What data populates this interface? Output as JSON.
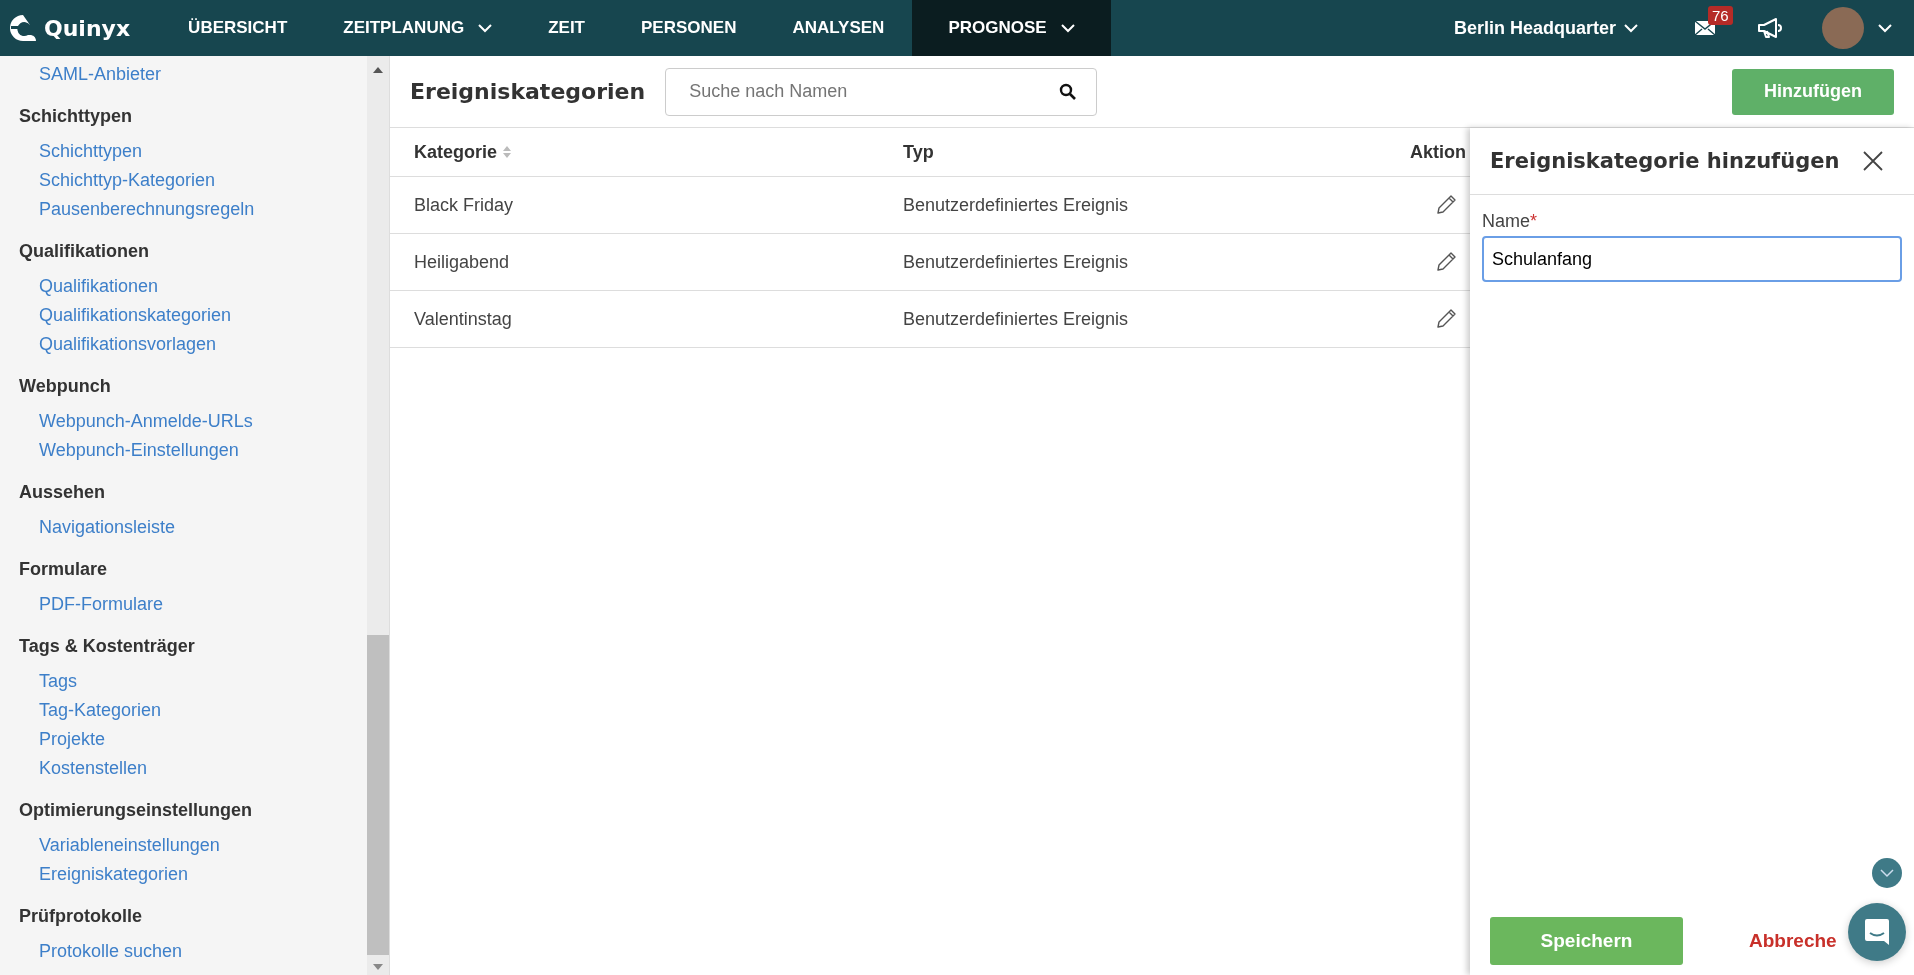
{
  "nav": {
    "logo": "Quinyx",
    "items": [
      {
        "label": "ÜBERSICHT",
        "has_menu": false,
        "selected": false
      },
      {
        "label": "ZEITPLANUNG",
        "has_menu": true,
        "selected": false
      },
      {
        "label": "ZEIT",
        "has_menu": false,
        "selected": false
      },
      {
        "label": "PERSONEN",
        "has_menu": false,
        "selected": false
      },
      {
        "label": "ANALYSEN",
        "has_menu": false,
        "selected": false
      },
      {
        "label": "PROGNOSE",
        "has_menu": true,
        "selected": true
      }
    ],
    "location": "Berlin Headquarter",
    "message_count": "76"
  },
  "sidebar": {
    "top_items": [
      "SAML-Anbieter"
    ],
    "sections": [
      {
        "title": "Schichttypen",
        "items": [
          "Schichttypen",
          "Schichttyp-Kategorien",
          "Pausenberechnungsregeln"
        ]
      },
      {
        "title": "Qualifikationen",
        "items": [
          "Qualifikationen",
          "Qualifikationskategorien",
          "Qualifikationsvorlagen"
        ]
      },
      {
        "title": "Webpunch",
        "items": [
          "Webpunch-Anmelde-URLs",
          "Webpunch-Einstellungen"
        ]
      },
      {
        "title": "Aussehen",
        "items": [
          "Navigationsleiste"
        ]
      },
      {
        "title": "Formulare",
        "items": [
          "PDF-Formulare"
        ]
      },
      {
        "title": "Tags & Kostenträger",
        "items": [
          "Tags",
          "Tag-Kategorien",
          "Projekte",
          "Kostenstellen"
        ]
      },
      {
        "title": "Optimierungseinstellungen",
        "items": [
          "Variableneinstellungen",
          "Ereigniskategorien"
        ]
      },
      {
        "title": "Prüfprotokolle",
        "items": [
          "Protokolle suchen"
        ]
      }
    ]
  },
  "page": {
    "title": "Ereigniskategorien",
    "search": {
      "placeholder": "Suche nach Namen"
    },
    "add_button": "Hinzufügen"
  },
  "table": {
    "columns": [
      {
        "label": "Kategorie",
        "sortable": true
      },
      {
        "label": "Typ",
        "sortable": false
      },
      {
        "label": "Aktion",
        "sortable": false
      }
    ],
    "rows": [
      {
        "kategorie": "Black Friday",
        "typ": "Benutzerdefiniertes Ereignis"
      },
      {
        "kategorie": "Heiligabend",
        "typ": "Benutzerdefiniertes Ereignis"
      },
      {
        "kategorie": "Valentinstag",
        "typ": "Benutzerdefiniertes Ereignis"
      }
    ]
  },
  "panel": {
    "title": "Ereigniskategorie hinzufügen",
    "field": {
      "label": "Name",
      "required_mark": "*",
      "value": "Schulanfang"
    },
    "save_button": "Speichern",
    "cancel_button": "Abbreche"
  }
}
